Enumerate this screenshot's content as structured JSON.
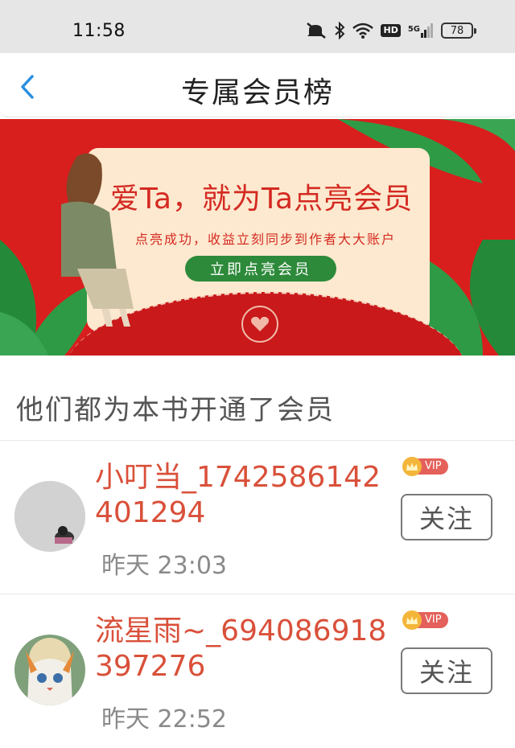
{
  "status_bar": {
    "time": "11:58",
    "battery": "78",
    "hd": "HD",
    "network": "5G"
  },
  "header": {
    "title": "专属会员榜"
  },
  "banner": {
    "headline": "爱Ta，就为Ta点亮会员",
    "subtitle": "点亮成功，收益立刻同步到作者大大账户",
    "cta_label": "立即点亮会员"
  },
  "section": {
    "title": "他们都为本书开通了会员"
  },
  "members": [
    {
      "name": "小叮当_1742586142401294",
      "time": "昨天 23:03",
      "vip": "VIP",
      "follow_label": "关注"
    },
    {
      "name": "流星雨~_694086918397276",
      "time": "昨天 22:52",
      "vip": "VIP",
      "follow_label": "关注"
    }
  ]
}
